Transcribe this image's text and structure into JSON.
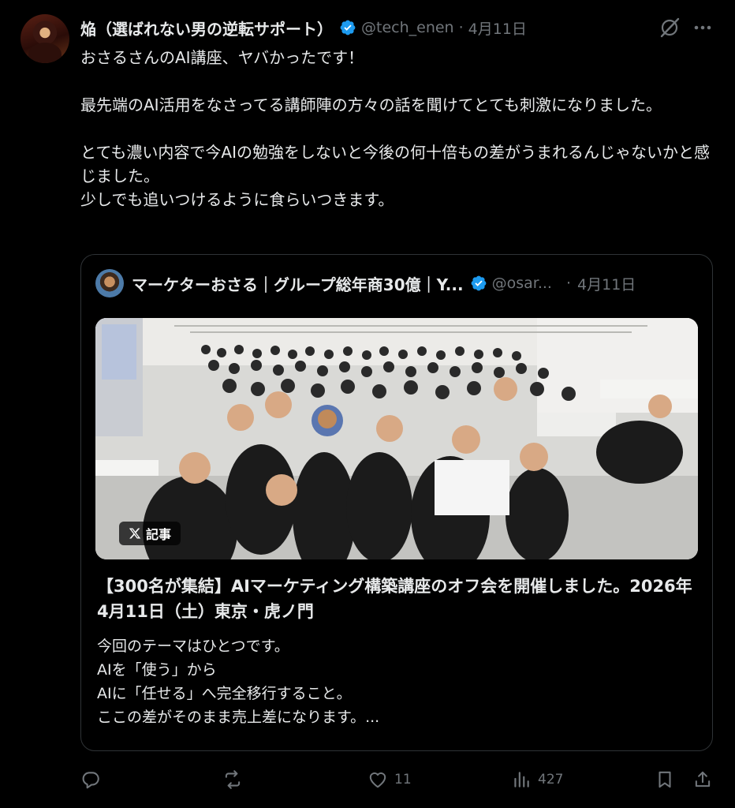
{
  "post": {
    "display_name": "焔（選ばれない男の逆転サポート）",
    "handle": "@tech_enen",
    "separator": "·",
    "date": "4月11日",
    "body": "おさるさんのAI講座、ヤバかったです！\n\n最先端のAI活用をなさってる講師陣の方々の話を聞けてとても刺激になりました。\n\nとても濃い内容で今AIの勉強をしないと今後の何十倍もの差がうまれるんじゃないかと感じました。\n少しでも追いつけるように食らいつきます。"
  },
  "quote": {
    "display_name": "マーケターおさる｜グループ総年商30億｜Y...",
    "handle": "@osar...",
    "separator": "·",
    "date": "4月11日",
    "media_badge": "記事",
    "article_title": "【300名が集結】AIマーケティング構築講座のオフ会を開催しました。2026年4月11日（土）東京・虎ノ門",
    "article_excerpt": "今回のテーマはひとつです。\nAIを「使う」から\nAIに「任せる」へ完全移行すること。\nここの差がそのまま売上差になります。..."
  },
  "actions": {
    "reply_count": "",
    "repost_count": "",
    "like_count": "11",
    "views_count": "427"
  },
  "colors": {
    "background": "#000000",
    "text": "#e7e9ea",
    "muted": "#71767b",
    "verified": "#1d9bf0",
    "border": "#2f3336"
  }
}
